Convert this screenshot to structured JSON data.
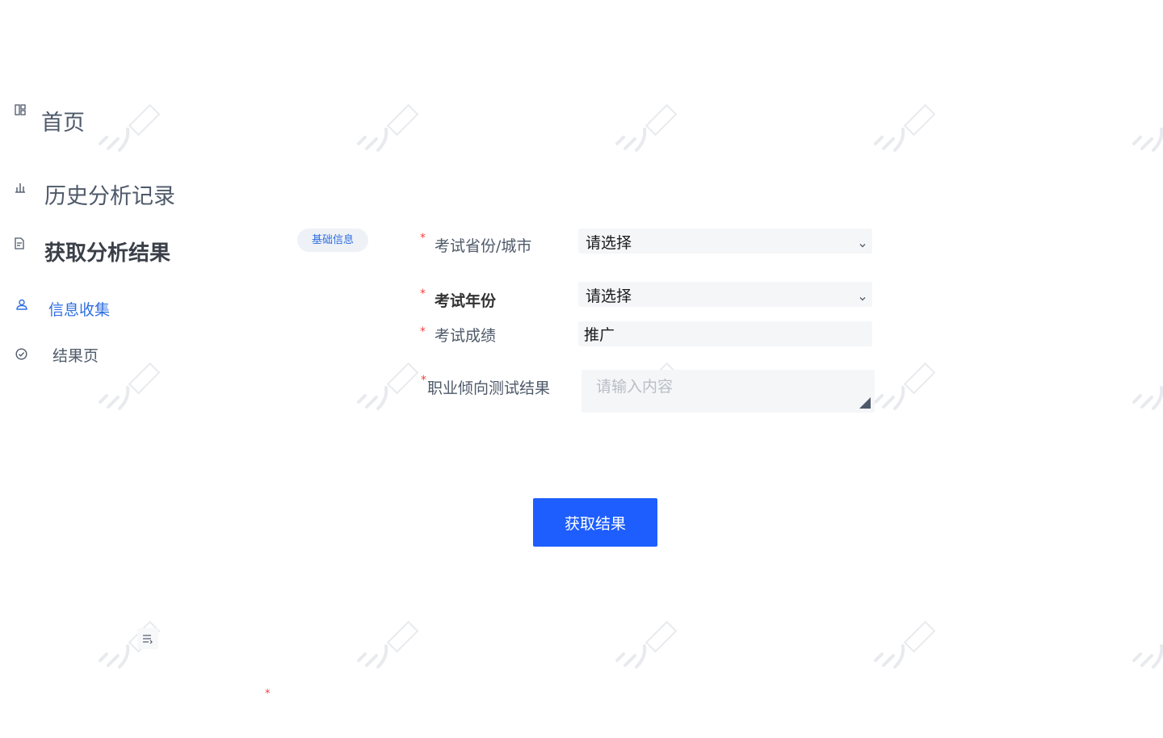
{
  "sidebar": {
    "items": [
      {
        "label": "首页",
        "icon": "dashboard-icon"
      },
      {
        "label": "历史分析记录",
        "icon": "bar-chart-icon"
      },
      {
        "label": "获取分析结果",
        "icon": "document-icon"
      },
      {
        "label": "信息收集",
        "icon": "user-icon",
        "active": true
      },
      {
        "label": "结果页",
        "icon": "check-circle-icon"
      }
    ]
  },
  "tag": {
    "label": "基础信息"
  },
  "form": {
    "province": {
      "required_mark": "*",
      "label": "考试省份/城市",
      "value": "请选择"
    },
    "year": {
      "required_mark": "*",
      "label": "考试年份",
      "value": "请选择"
    },
    "score": {
      "required_mark": "*",
      "label": "考试成绩",
      "value": "推广"
    },
    "career": {
      "required_mark": "*",
      "label": "职业倾向测试结果",
      "placeholder": "请输入内容"
    }
  },
  "actions": {
    "submit_label": "获取结果"
  },
  "extras": {
    "stray_required_mark": "*"
  },
  "colors": {
    "primary": "#1e5eff",
    "active_nav": "#2f6fe0",
    "required": "#f53f3f",
    "field_bg": "#f5f6f8"
  }
}
